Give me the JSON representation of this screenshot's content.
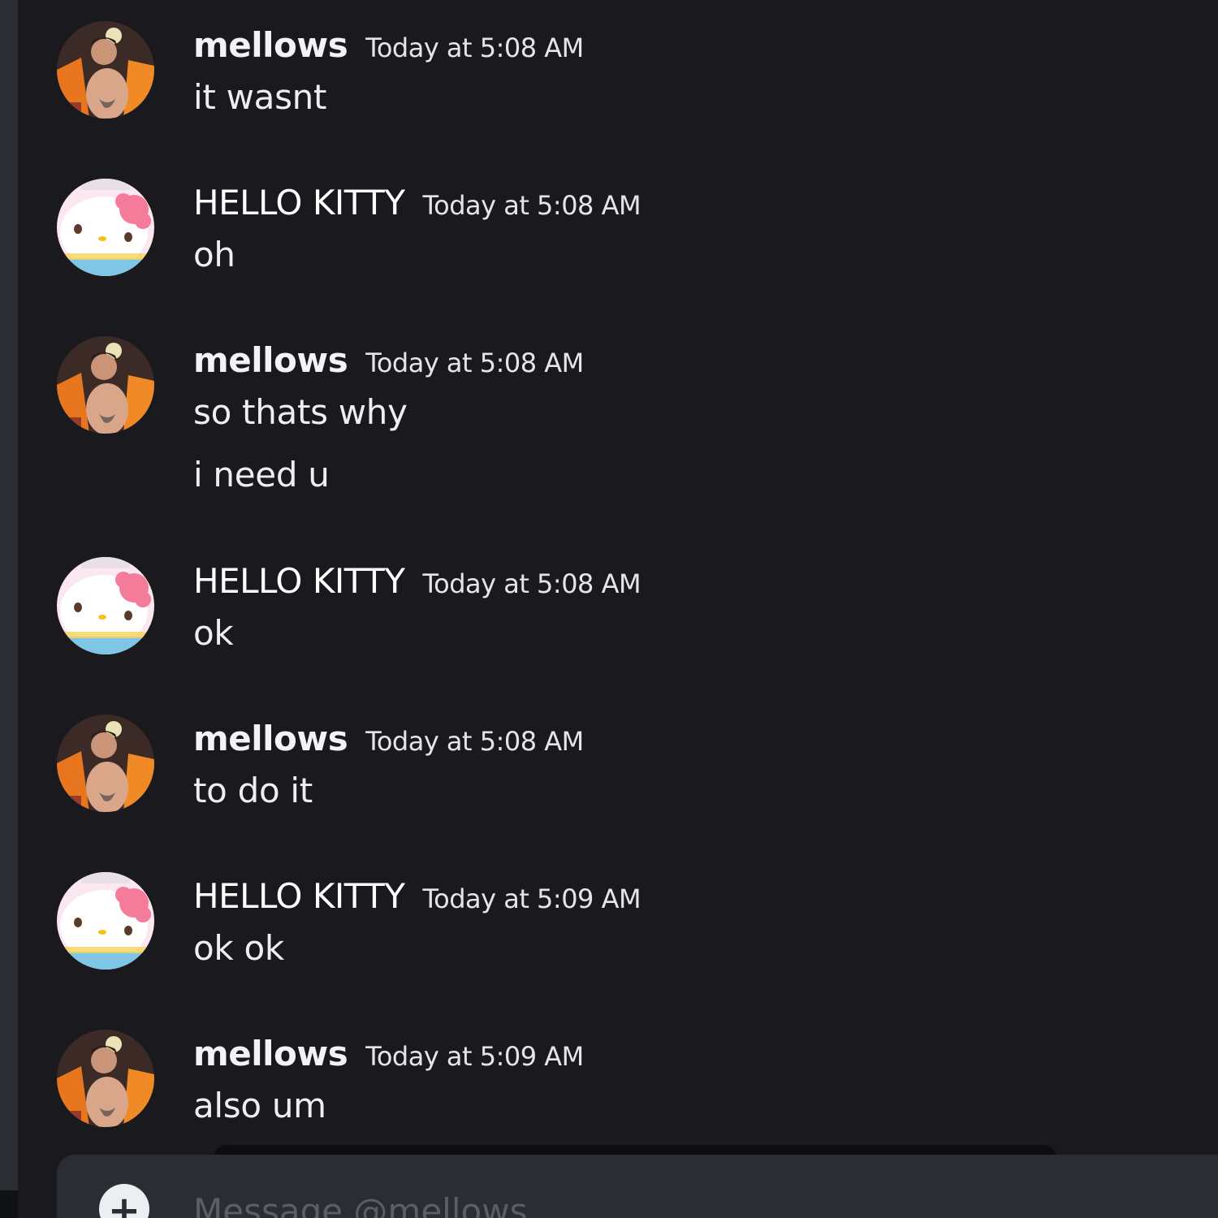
{
  "users": {
    "mellows": {
      "name": "mellows",
      "avatar_icon": "concert-performer-avatar"
    },
    "kitty": {
      "name": "HELLO KITTY",
      "avatar_icon": "hello-kitty-avatar"
    }
  },
  "messages": [
    {
      "author": "mellows",
      "timestamp": "Today at 5:08 AM",
      "lines": [
        "it wasnt"
      ]
    },
    {
      "author": "HELLO KITTY",
      "timestamp": "Today at 5:08 AM",
      "lines": [
        "oh"
      ]
    },
    {
      "author": "mellows",
      "timestamp": "Today at 5:08 AM",
      "lines": [
        "so thats why",
        "i need u"
      ]
    },
    {
      "author": "HELLO KITTY",
      "timestamp": "Today at 5:08 AM",
      "lines": [
        "ok"
      ]
    },
    {
      "author": "mellows",
      "timestamp": "Today at 5:08 AM",
      "lines": [
        "to do it"
      ]
    },
    {
      "author": "HELLO KITTY",
      "timestamp": "Today at 5:09 AM",
      "lines": [
        "ok ok"
      ]
    },
    {
      "author": "mellows",
      "timestamp": "Today at 5:09 AM",
      "lines": [
        "also um"
      ]
    }
  ],
  "composer": {
    "placeholder": "Message @mellows",
    "add_icon": "plus-circle-icon"
  },
  "colors": {
    "background": "#1a1a1e",
    "composer": "#2b2d34",
    "text": "#eceef1"
  }
}
